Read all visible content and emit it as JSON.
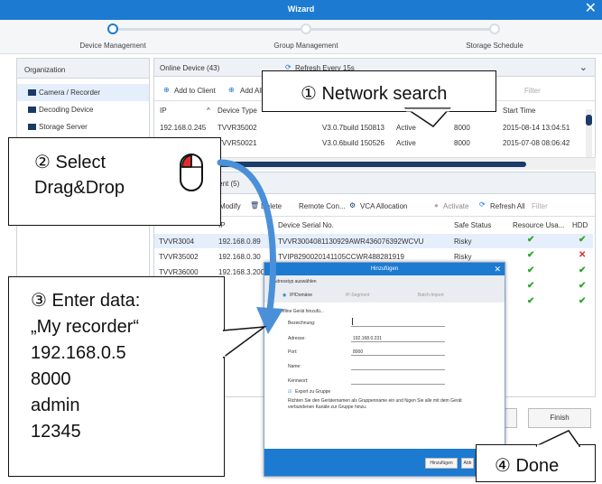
{
  "window": {
    "title": "Wizard",
    "close": "✕"
  },
  "stepper": {
    "steps": [
      "Device Management",
      "Group Management",
      "Storage Schedule"
    ]
  },
  "org": {
    "title": "Organization",
    "items": [
      "Camera / Recorder",
      "Decoding Device",
      "Storage Server"
    ]
  },
  "online": {
    "title": "Online Device (43)",
    "refresh": "Refresh Every 15s",
    "add_to_client": "Add to Client",
    "add_all": "Add All",
    "filter": "Filter",
    "columns": [
      "IP",
      "Device Type",
      "Start Time"
    ],
    "rows": [
      {
        "ip": "192.168.0.245",
        "type": "TVVR35002",
        "fw": "V3.0.7build 150813",
        "status": "Active",
        "port": "8000",
        "time": "2015-08-14 13:04:51"
      },
      {
        "ip": "",
        "type": "TVVR50021",
        "fw": "V3.0.6build 150526",
        "status": "Active",
        "port": "8000",
        "time": "2015-07-08 08:06:42"
      }
    ]
  },
  "mgmt": {
    "title": "ement (5)",
    "modify": "Modify",
    "delete": "Delete",
    "remote_config": "Remote Con...",
    "vca_allocation": "VCA Allocation",
    "activate": "Activate",
    "refresh_all": "Refresh All",
    "filter": "Filter",
    "columns": [
      "IP",
      "Device Serial No.",
      "Safe Status",
      "Resource Usa...",
      "HDD"
    ],
    "rows": [
      {
        "name": "TVVR3004",
        "ip": "192.168.0.89",
        "serial": "TVVR3004081130929AWR436076392WCVU",
        "status": "Risky",
        "res": "✔",
        "hdd": "✔"
      },
      {
        "name": "TVVR35002",
        "ip": "192.168.0.30",
        "serial": "TVIP8290020141105CCWR488281919",
        "status": "Risky",
        "res": "✔",
        "hdd": "✕"
      },
      {
        "name": "TVVR36000",
        "ip": "192.168.3.200",
        "serial": "",
        "status": "",
        "res": "✔",
        "hdd": "✔"
      },
      {
        "name": "",
        "ip": "",
        "serial": "",
        "status": "",
        "res": "✔",
        "hdd": "✔"
      },
      {
        "name": "",
        "ip": "",
        "serial": "",
        "status": "",
        "res": "✔",
        "hdd": "✔"
      }
    ]
  },
  "buttons": {
    "finish": "Finish"
  },
  "dialog": {
    "title": "Hinzufügen",
    "address_type": "Adresstyp auswählen",
    "opt_ip": "IP/Domäne",
    "opt_segment": "IP-Segment",
    "opt_batch": "Batch-Import",
    "offline": "Offline Gerät hinzufü...",
    "labels": [
      "Bezeichnung:",
      "Adresse:",
      "Port:",
      "Name:",
      "Kennwort:"
    ],
    "address_value": "192.168.0.231",
    "port_value": "8000",
    "export_group": "Export zu Gruppe",
    "hint": "Richten Sie den Geräternamen als Gruppenname ein und fügen Sie alle mit dem Gerät verbundenen Kanäle zur Gruppe hinzu.",
    "add": "Hinzufügen",
    "cancel": "Abb"
  },
  "callouts": {
    "network_search": "① Network search",
    "select": "② Select",
    "dragdrop": "Drag&Drop",
    "enter": [
      "③ Enter data:",
      "„My recorder“",
      "192.168.0.5",
      "8000",
      "admin",
      "12345"
    ],
    "done": "④ Done"
  },
  "colors": {
    "titlebar": "#1c7ad1",
    "accent": "#2f80d6",
    "check": "#2aa52a",
    "cross": "#e02c2c"
  }
}
